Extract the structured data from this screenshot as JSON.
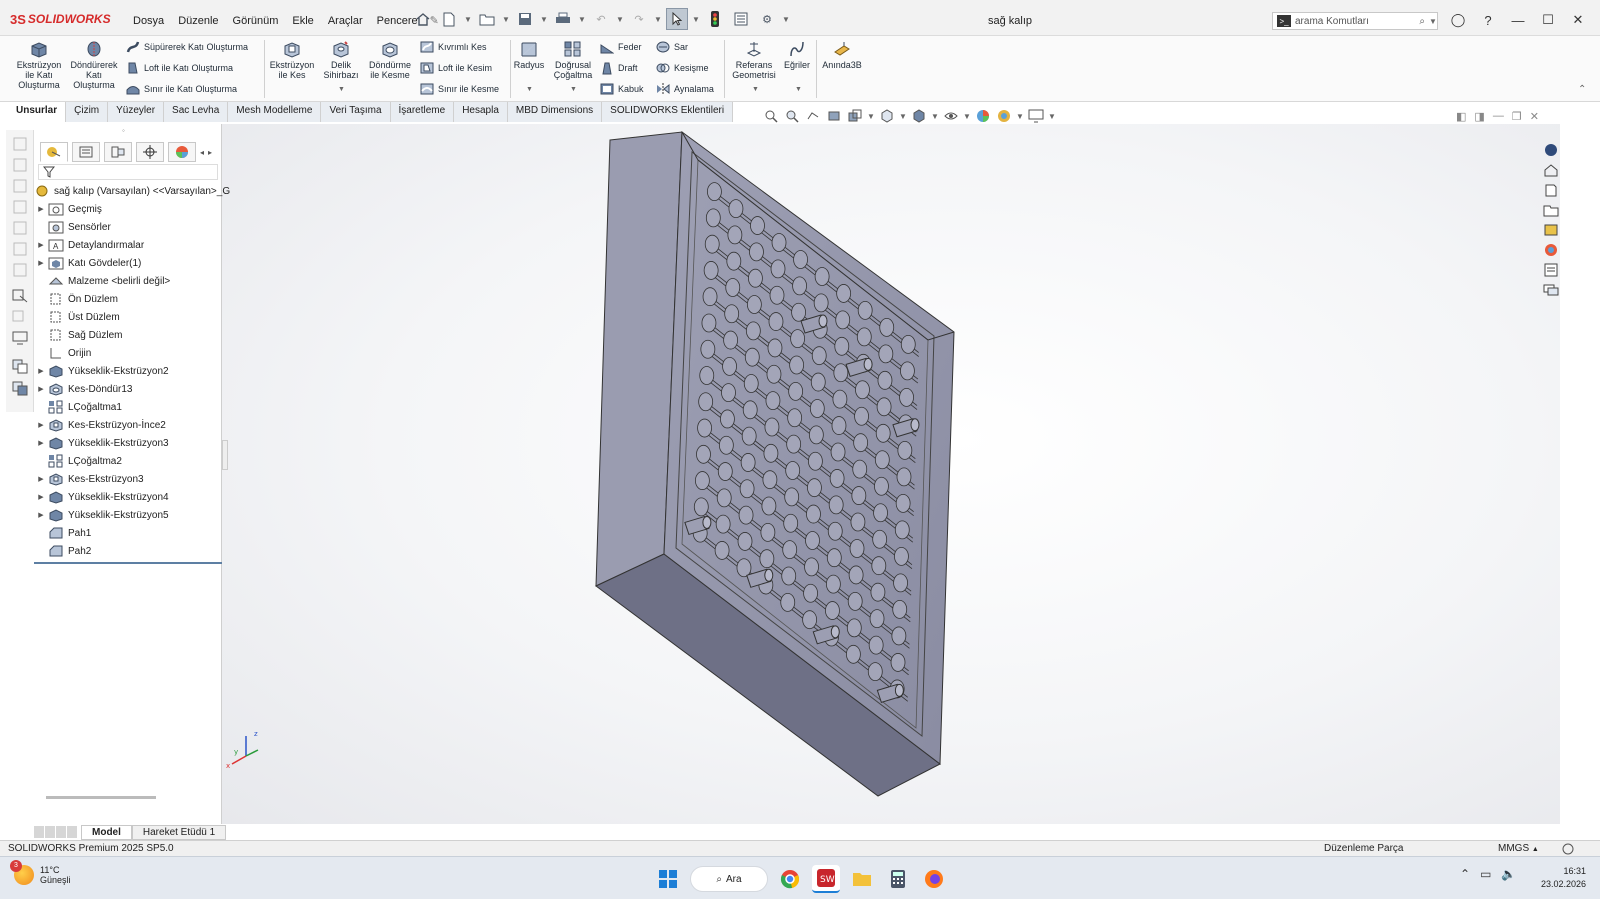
{
  "app": {
    "logo_text": "SOLIDWORKS",
    "document_title": "sağ kalıp"
  },
  "menu": [
    "Dosya",
    "Düzenle",
    "Görünüm",
    "Ekle",
    "Araçlar",
    "Pencere"
  ],
  "search": {
    "placeholder": "arama Komutları"
  },
  "command_manager": {
    "extrude_boss": "Ekstrüzyon ile Katı Oluşturma",
    "revolve_boss": "Döndürerek Katı Oluşturma",
    "sweep_boss": "Süpürerek Katı Oluşturma",
    "loft_boss": "Loft ile Katı Oluşturma",
    "boundary_boss": "Sınır ile Katı Oluşturma",
    "extrude_cut": "Ekstrüzyon ile Kes",
    "hole_wizard": "Delik Sihirbazı",
    "revolve_cut": "Döndürme ile Kesme",
    "sweep_cut": "Kıvrımlı Kes",
    "loft_cut": "Loft ile Kesim",
    "boundary_cut": "Sınır ile Kesme",
    "fillet": "Radyus",
    "linear_pattern": "Doğrusal Çoğaltma",
    "rib": "Feder",
    "draft": "Draft",
    "shell": "Kabuk",
    "wrap": "Sar",
    "intersect": "Kesişme",
    "mirror": "Aynalama",
    "ref_geometry": "Referans Geometrisi",
    "curves": "Eğriler",
    "instant3d": "Anında3B"
  },
  "tabs": [
    "Unsurlar",
    "Çizim",
    "Yüzeyler",
    "Sac Levha",
    "Mesh Modelleme",
    "Veri Taşıma",
    "İşaretleme",
    "Hesapla",
    "MBD Dimensions",
    "SOLIDWORKS Eklentileri"
  ],
  "active_tab": "Unsurlar",
  "tree": {
    "root": "sağ kalıp (Varsayılan) <<Varsayılan>_G",
    "items": [
      {
        "label": "Geçmiş",
        "expandable": true,
        "icon": "history-folder-icon"
      },
      {
        "label": "Sensörler",
        "expandable": false,
        "icon": "sensor-icon"
      },
      {
        "label": "Detaylandırmalar",
        "expandable": true,
        "icon": "annotations-icon"
      },
      {
        "label": "Katı Gövdeler(1)",
        "expandable": true,
        "icon": "solid-bodies-icon"
      },
      {
        "label": "Malzeme <belirli değil>",
        "expandable": false,
        "icon": "material-icon"
      },
      {
        "label": "Ön Düzlem",
        "expandable": false,
        "icon": "plane-icon"
      },
      {
        "label": "Üst Düzlem",
        "expandable": false,
        "icon": "plane-icon"
      },
      {
        "label": "Sağ Düzlem",
        "expandable": false,
        "icon": "plane-icon"
      },
      {
        "label": "Orijin",
        "expandable": false,
        "icon": "origin-icon"
      },
      {
        "label": "Yükseklik-Ekstrüzyon2",
        "expandable": true,
        "icon": "extrude-feature-icon"
      },
      {
        "label": "Kes-Döndür13",
        "expandable": true,
        "icon": "revolve-cut-icon"
      },
      {
        "label": "LÇoğaltma1",
        "expandable": false,
        "icon": "linear-pattern-icon"
      },
      {
        "label": "Kes-Ekstrüzyon-İnce2",
        "expandable": true,
        "icon": "extrude-cut-icon"
      },
      {
        "label": "Yükseklik-Ekstrüzyon3",
        "expandable": true,
        "icon": "extrude-feature-icon"
      },
      {
        "label": "LÇoğaltma2",
        "expandable": false,
        "icon": "linear-pattern-icon"
      },
      {
        "label": "Kes-Ekstrüzyon3",
        "expandable": true,
        "icon": "extrude-cut-icon"
      },
      {
        "label": "Yükseklik-Ekstrüzyon4",
        "expandable": true,
        "icon": "extrude-feature-icon"
      },
      {
        "label": "Yükseklik-Ekstrüzyon5",
        "expandable": true,
        "icon": "extrude-feature-icon"
      },
      {
        "label": "Pah1",
        "expandable": false,
        "icon": "chamfer-icon"
      },
      {
        "label": "Pah2",
        "expandable": false,
        "icon": "chamfer-icon"
      }
    ]
  },
  "bottom_tabs": [
    "Model",
    "Hareket Etüdü 1"
  ],
  "status": {
    "version": "SOLIDWORKS Premium 2025 SP5.0",
    "mode": "Düzenleme Parça",
    "units": "MMGS"
  },
  "triad": {
    "z": "z",
    "y": "y",
    "x": "x"
  },
  "taskbar": {
    "weather_badge": "3",
    "weather_temp": "11°C",
    "weather_desc": "Güneşli",
    "search_label": "Ara",
    "time": "16:31",
    "date": "23.02.2026"
  },
  "colors": {
    "accent": "#5d7fa3",
    "part": "#8e90a6",
    "brand_red": "#d62b2b"
  }
}
